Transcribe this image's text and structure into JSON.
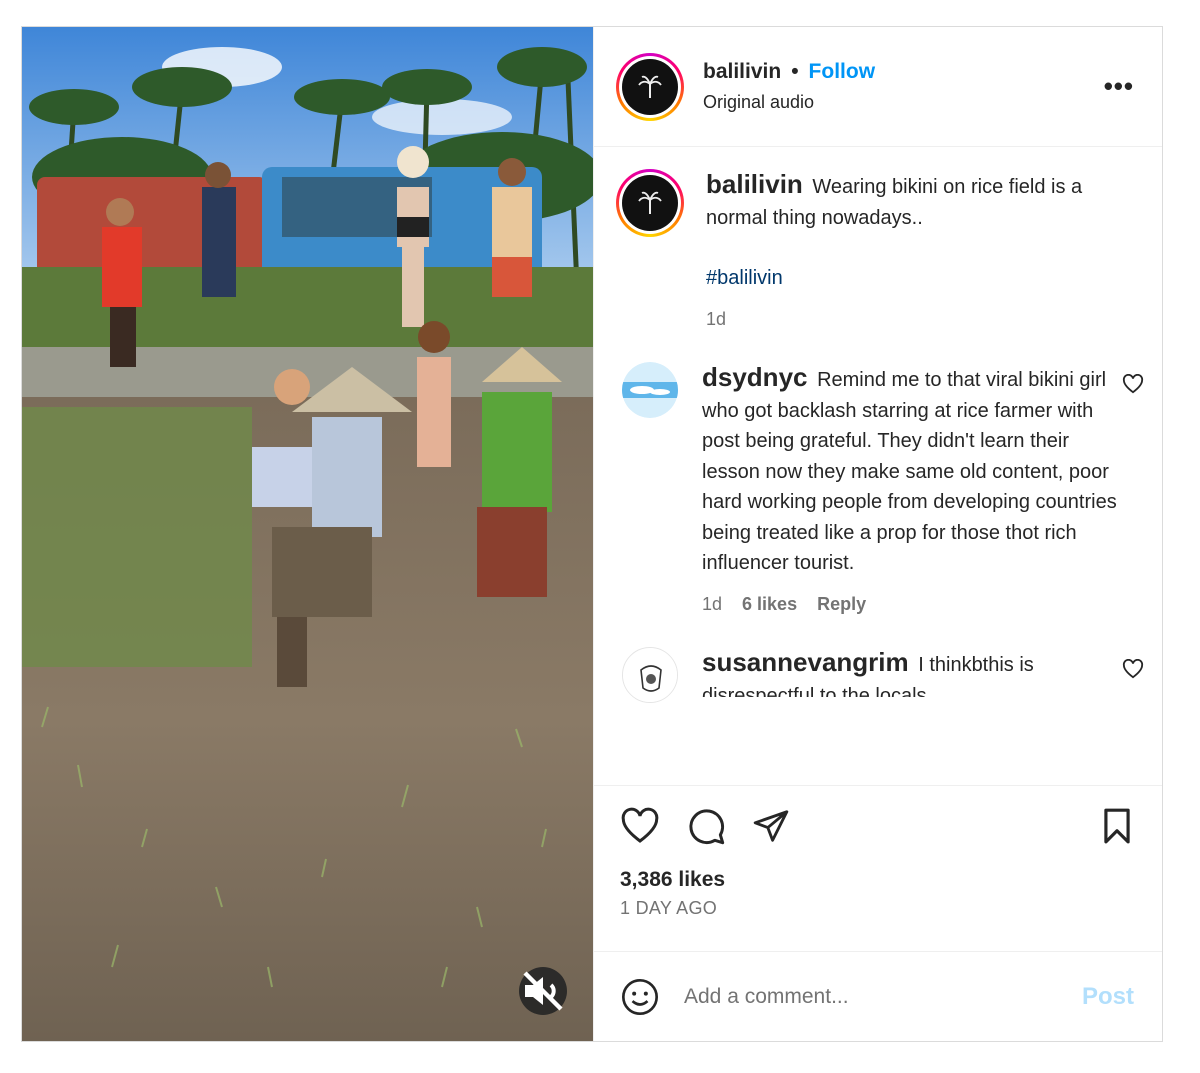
{
  "header": {
    "username": "balilivin",
    "separator": "•",
    "follow_label": "Follow",
    "subtitle": "Original audio",
    "more_label": "•••"
  },
  "caption": {
    "username": "balilivin",
    "text": "Wearing bikini on rice field is a normal thing nowadays..",
    "hashtag": "#balilivin",
    "age": "1d"
  },
  "comments": [
    {
      "username": "dsydnyc",
      "text": "Remind me to that viral bikini girl who got backlash starring at rice farmer with post being grateful. They didn't learn their lesson now they make same old content, poor hard working people from developing countries being treated like a prop for those thot rich influencer tourist.",
      "age": "1d",
      "likes": "6 likes",
      "reply_label": "Reply"
    },
    {
      "username": "susannevangrim",
      "text": "I thinkbthis is disrespectful to the locals"
    }
  ],
  "actions": {
    "likes": "3,386 likes",
    "date": "1 DAY AGO"
  },
  "add_comment": {
    "placeholder": "Add a comment...",
    "post_label": "Post"
  },
  "icons": {
    "mute": "speaker-muted-icon",
    "like": "heart-icon",
    "comment": "comment-bubble-icon",
    "share": "paper-plane-icon",
    "save": "bookmark-icon",
    "emoji": "smiley-icon"
  },
  "colors": {
    "follow": "#0095f6",
    "hashtag": "#00376b",
    "post_disabled": "#b2dffc",
    "muted_text": "#737373"
  }
}
